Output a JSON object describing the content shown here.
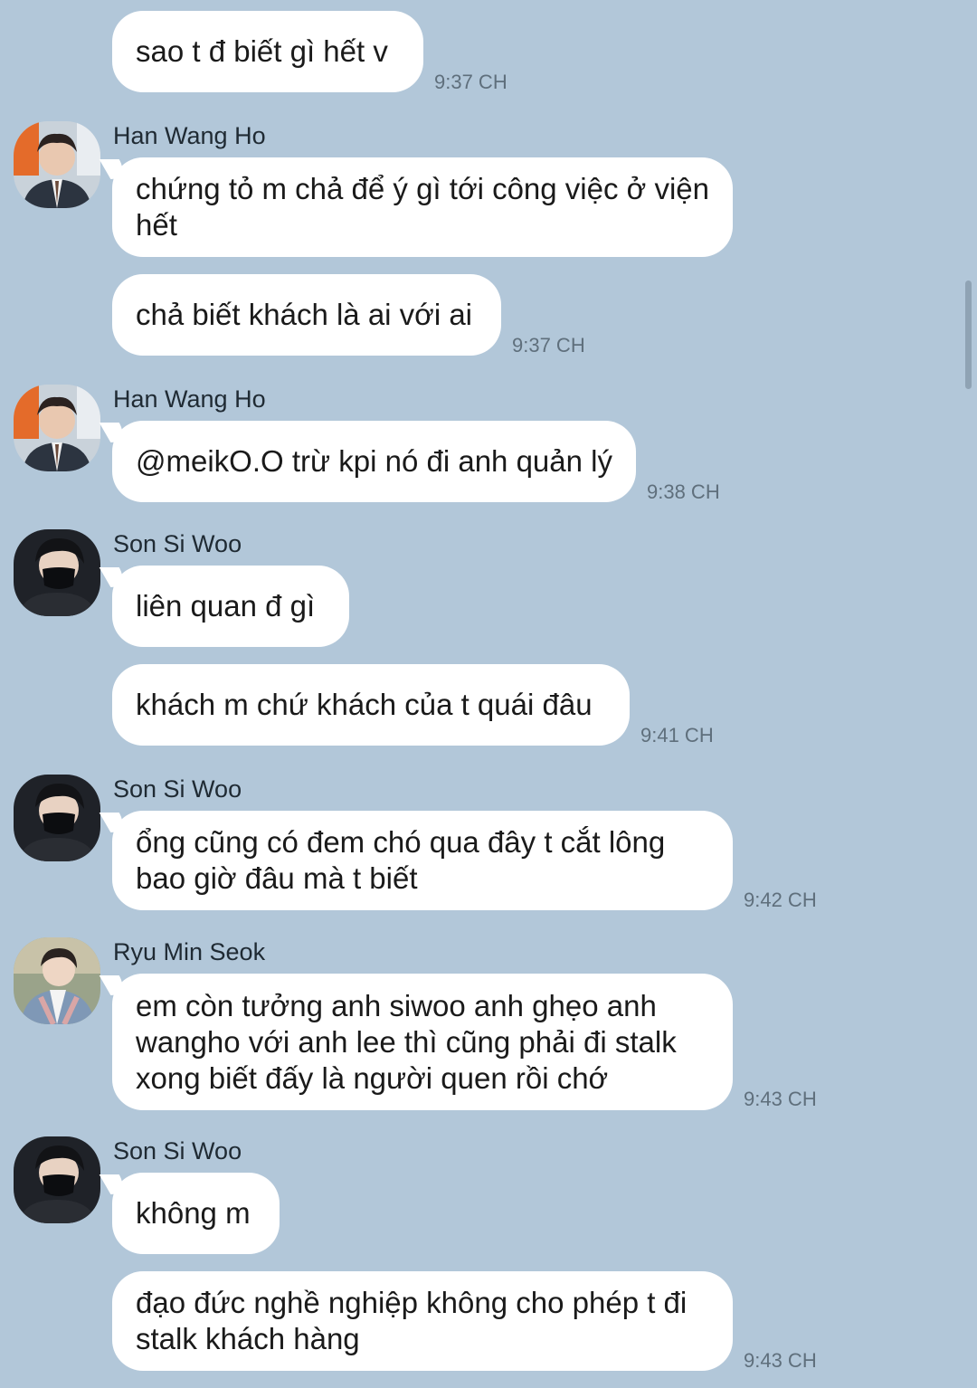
{
  "messages": [
    {
      "text": "sao t đ biết gì hết v",
      "time": "9:37 CH"
    },
    {
      "sender": "Han Wang Ho",
      "text": "chứng tỏ m chả để ý gì tới công việc ở viện hết"
    },
    {
      "text": "chả biết khách là ai với ai",
      "time": "9:37 CH"
    },
    {
      "sender": "Han Wang Ho",
      "text": "@meikO.O trừ kpi nó đi anh quản lý",
      "time": "9:38 CH"
    },
    {
      "sender": "Son Si Woo",
      "text": "liên quan đ gì"
    },
    {
      "text": "khách m chứ khách của t quái đâu",
      "time": "9:41 CH"
    },
    {
      "sender": "Son Si Woo",
      "text": "ổng cũng có đem chó qua đây t cắt lông bao giờ đâu mà t biết",
      "time": "9:42 CH"
    },
    {
      "sender": "Ryu Min Seok",
      "text": "em còn tưởng anh siwoo anh ghẹo anh wangho với anh lee thì cũng phải đi stalk xong biết đấy là người quen rồi chớ",
      "time": "9:43 CH"
    },
    {
      "sender": "Son Si Woo",
      "text": "không m"
    },
    {
      "text": "đạo đức nghề nghiệp không cho phép t đi stalk khách hàng",
      "time": "9:43 CH"
    }
  ],
  "avatars": {
    "han": "han-wang-ho-avatar",
    "son": "son-si-woo-avatar",
    "ryu": "ryu-min-seok-avatar"
  },
  "colors": {
    "background": "#b2c7d9",
    "bubble": "#ffffff",
    "timestamp": "#5f6f7c"
  }
}
